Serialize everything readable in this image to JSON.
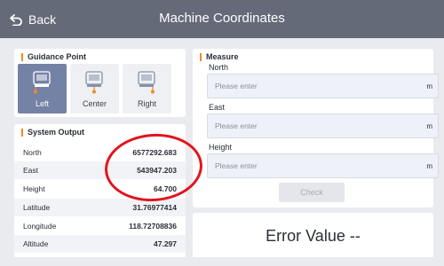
{
  "header": {
    "back_label": "Back",
    "title": "Machine Coordinates"
  },
  "guidance": {
    "title": "Guidance Point",
    "options": [
      {
        "label": "Left",
        "active": true
      },
      {
        "label": "Center",
        "active": false
      },
      {
        "label": "Right",
        "active": false
      }
    ]
  },
  "system_output": {
    "title": "System Output",
    "rows": [
      {
        "label": "North",
        "value": "6577292.683"
      },
      {
        "label": "East",
        "value": "543947.203"
      },
      {
        "label": "Height",
        "value": "64.700"
      },
      {
        "label": "Latitude",
        "value": "31.76977414"
      },
      {
        "label": "Longitude",
        "value": "118.72708836"
      },
      {
        "label": "Altitude",
        "value": "47.297"
      }
    ]
  },
  "measure": {
    "title": "Measure",
    "fields": [
      {
        "label": "North",
        "placeholder": "Please enter",
        "unit": "m"
      },
      {
        "label": "East",
        "placeholder": "Please enter",
        "unit": "m"
      },
      {
        "label": "Height",
        "placeholder": "Please enter",
        "unit": "m"
      }
    ],
    "check_label": "Check"
  },
  "error": {
    "text": "Error Value --"
  },
  "colors": {
    "header": "#646a78",
    "accent": "#f08a24",
    "active": "#7482a6",
    "highlight": "#e1141d"
  }
}
